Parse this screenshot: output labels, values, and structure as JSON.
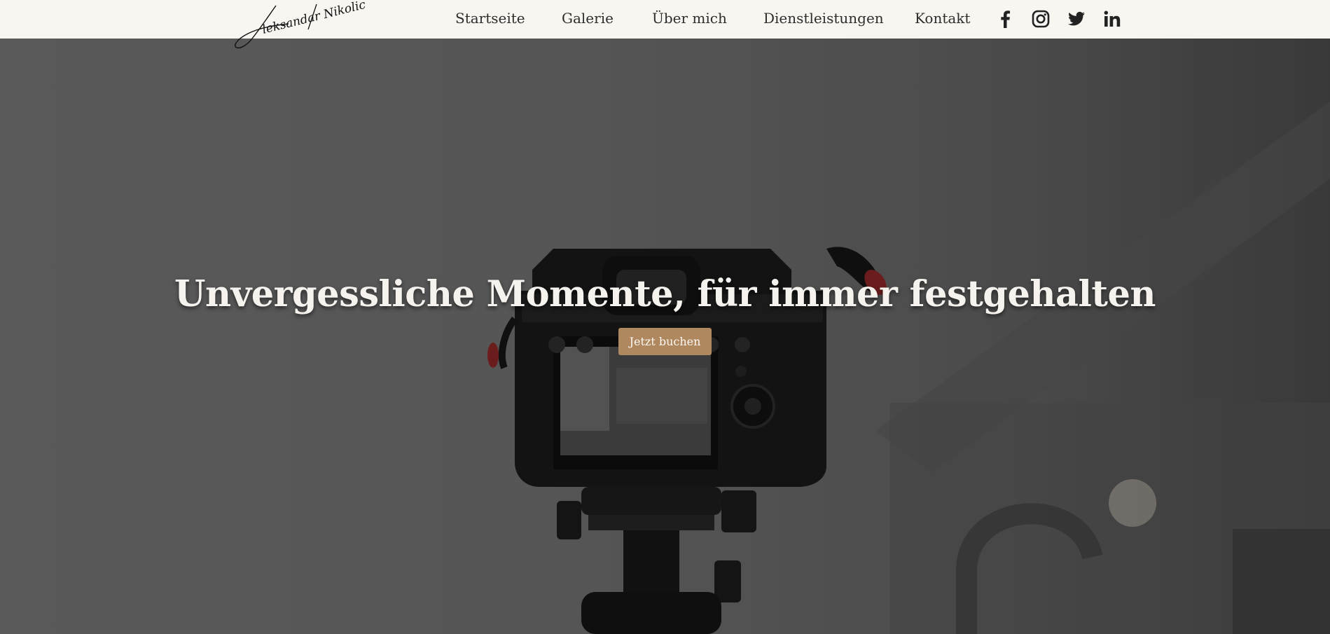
{
  "brand": {
    "signature": "Aleksandar Nikolic"
  },
  "nav": {
    "items": [
      {
        "label": "Startseite"
      },
      {
        "label": "Galerie"
      },
      {
        "label": "Über mich"
      },
      {
        "label": "Dienstleistungen"
      },
      {
        "label": "Kontakt"
      }
    ]
  },
  "social": {
    "icons": [
      "facebook-icon",
      "instagram-icon",
      "twitter-icon",
      "linkedin-icon"
    ]
  },
  "hero": {
    "title": "Unvergessliche Momente, für immer festgehalten",
    "cta_label": "Jetzt buchen"
  },
  "colors": {
    "topbar_bg": "#f8f6f1",
    "accent": "#b0885f",
    "nav_text": "#2d2d2d",
    "hero_text": "#f6f3ee"
  }
}
